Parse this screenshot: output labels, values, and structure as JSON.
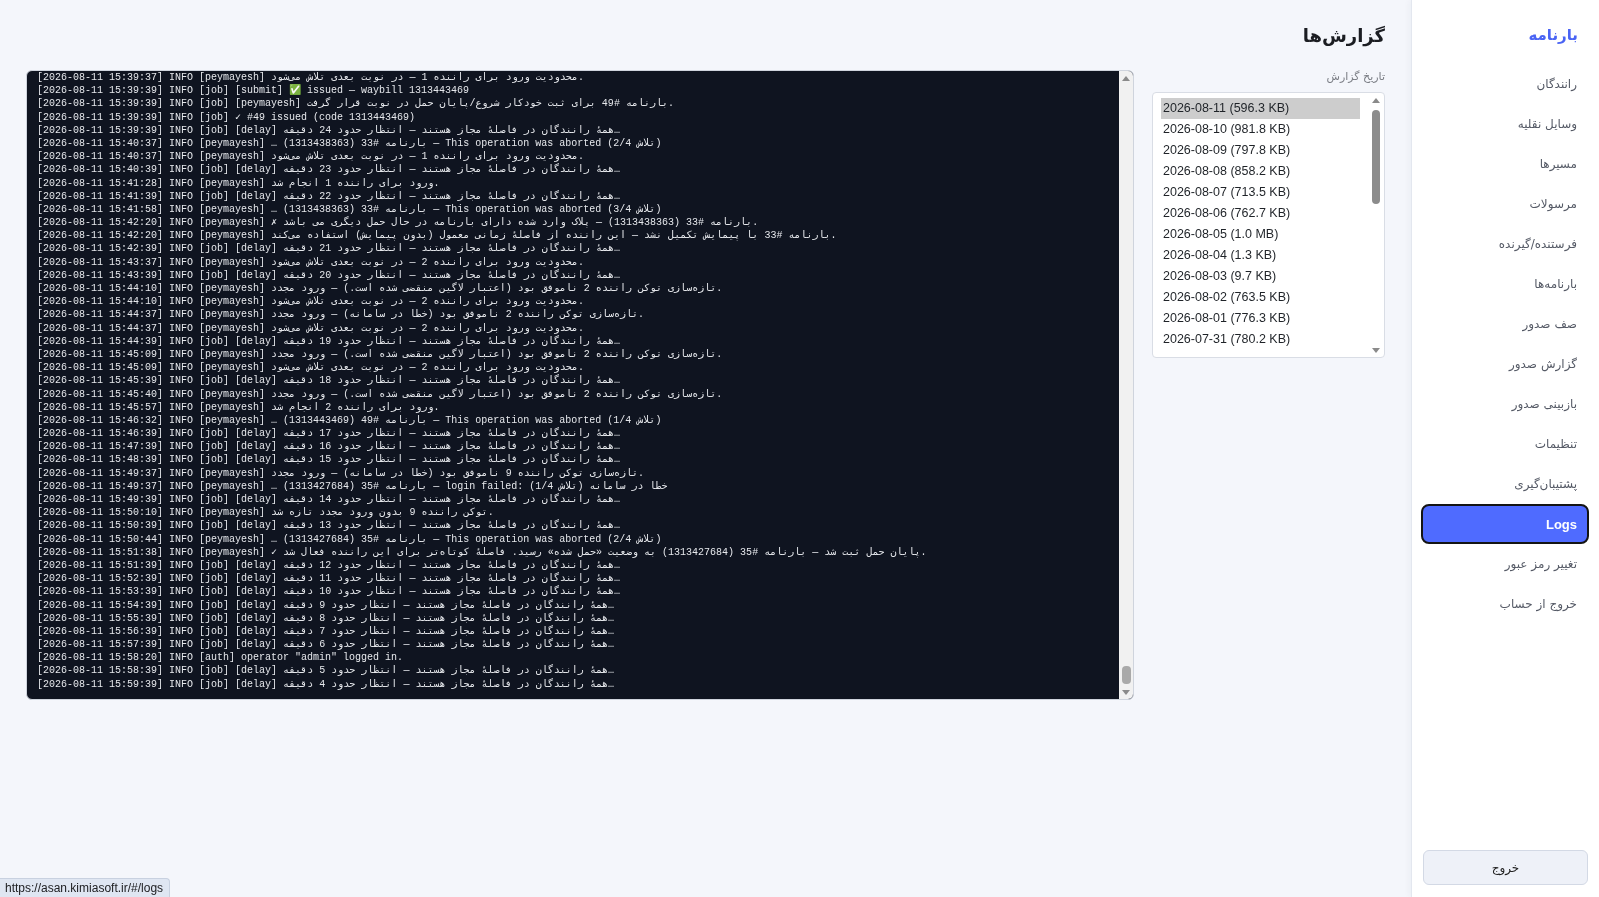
{
  "header": {
    "title": "گزارش‌ها"
  },
  "log": {
    "lines": [
      "[2026-08-11 15:39:37] INFO [peymayesh] محدودیت ورود برای راننده 1 — در نوبت بعدی تلاش می‌شود.",
      "[2026-08-11 15:39:39] INFO [job] [submit] ✅ issued — waybill 1313443469",
      "[2026-08-11 15:39:39] INFO [job] [peymayesh] بارنامه #49 برای ثبت خودکار شروع/پایان حمل در نوبت قرار گرفت.",
      "[2026-08-11 15:39:39] INFO [job] ✓ #49 issued (code 1313443469)",
      "[2026-08-11 15:39:39] INFO [job] [delay] همهٔ رانندگان در فاصلهٔ مجاز هستند — انتظار حدود 24 دقیقه…",
      "[2026-08-11 15:40:37] INFO [peymayesh] … بارنامه #33 (1313438363) — This operation was aborted (تلاش 2/4)",
      "[2026-08-11 15:40:37] INFO [peymayesh] محدودیت ورود برای راننده 1 — در نوبت بعدی تلاش می‌شود.",
      "[2026-08-11 15:40:39] INFO [job] [delay] همهٔ رانندگان در فاصلهٔ مجاز هستند — انتظار حدود 23 دقیقه…",
      "[2026-08-11 15:41:28] INFO [peymayesh] ورود برای راننده 1 انجام شد.",
      "[2026-08-11 15:41:39] INFO [job] [delay] همهٔ رانندگان در فاصلهٔ مجاز هستند — انتظار حدود 22 دقیقه…",
      "[2026-08-11 15:41:58] INFO [peymayesh] … بارنامه #33 (1313438363) — This operation was aborted (تلاش 3/4)",
      "[2026-08-11 15:42:20] INFO [peymayesh] ✗ بارنامه #33 (1313438363) — پلاک وارد شده دارای بارنامه در حال حمل دیگری می باشد.",
      "[2026-08-11 15:42:20] INFO [peymayesh] بارنامه #33 با پیمایش تکمیل نشد — این راننده از فاصلهٔ زمانی معمول (بدون پیمایش) استفاده می‌کند.",
      "[2026-08-11 15:42:39] INFO [job] [delay] همهٔ رانندگان در فاصلهٔ مجاز هستند — انتظار حدود 21 دقیقه…",
      "[2026-08-11 15:43:37] INFO [peymayesh] محدودیت ورود برای راننده 2 — در نوبت بعدی تلاش می‌شود.",
      "[2026-08-11 15:43:39] INFO [job] [delay] همهٔ رانندگان در فاصلهٔ مجاز هستند — انتظار حدود 20 دقیقه…",
      "[2026-08-11 15:44:10] INFO [peymayesh] تازه‌سازی توکن راننده 2 ناموفق بود (اعتبار لاگین منقضی شده است.) — ورود مجدد.",
      "[2026-08-11 15:44:10] INFO [peymayesh] محدودیت ورود برای راننده 2 — در نوبت بعدی تلاش می‌شود.",
      "[2026-08-11 15:44:37] INFO [peymayesh] تازه‌سازی توکن راننده 2 ناموفق بود (خطا در سامانه) — ورود مجدد.",
      "[2026-08-11 15:44:37] INFO [peymayesh] محدودیت ورود برای راننده 2 — در نوبت بعدی تلاش می‌شود.",
      "[2026-08-11 15:44:39] INFO [job] [delay] همهٔ رانندگان در فاصلهٔ مجاز هستند — انتظار حدود 19 دقیقه…",
      "[2026-08-11 15:45:09] INFO [peymayesh] تازه‌سازی توکن راننده 2 ناموفق بود (اعتبار لاگین منقضی شده است.) — ورود مجدد.",
      "[2026-08-11 15:45:09] INFO [peymayesh] محدودیت ورود برای راننده 2 — در نوبت بعدی تلاش می‌شود.",
      "[2026-08-11 15:45:39] INFO [job] [delay] همهٔ رانندگان در فاصلهٔ مجاز هستند — انتظار حدود 18 دقیقه…",
      "[2026-08-11 15:45:40] INFO [peymayesh] تازه‌سازی توکن راننده 2 ناموفق بود (اعتبار لاگین منقضی شده است.) — ورود مجدد.",
      "[2026-08-11 15:45:57] INFO [peymayesh] ورود برای راننده 2 انجام شد.",
      "[2026-08-11 15:46:32] INFO [peymayesh] … بارنامه #49 (1313443469) — This operation was aborted (تلاش 1/4)",
      "[2026-08-11 15:46:39] INFO [job] [delay] همهٔ رانندگان در فاصلهٔ مجاز هستند — انتظار حدود 17 دقیقه…",
      "[2026-08-11 15:47:39] INFO [job] [delay] همهٔ رانندگان در فاصلهٔ مجاز هستند — انتظار حدود 16 دقیقه…",
      "[2026-08-11 15:48:39] INFO [job] [delay] همهٔ رانندگان در فاصلهٔ مجاز هستند — انتظار حدود 15 دقیقه…",
      "[2026-08-11 15:49:37] INFO [peymayesh] تازه‌سازی توکن راننده 9 ناموفق بود (خطا در سامانه) — ورود مجدد.",
      "[2026-08-11 15:49:37] INFO [peymayesh] … بارنامه #35 (1313427684) — login failed: خطا در سامانه (تلاش 1/4)",
      "[2026-08-11 15:49:39] INFO [job] [delay] همهٔ رانندگان در فاصلهٔ مجاز هستند — انتظار حدود 14 دقیقه…",
      "[2026-08-11 15:50:10] INFO [peymayesh] توکن راننده 9 بدون ورود مجدد تازه شد.",
      "[2026-08-11 15:50:39] INFO [job] [delay] همهٔ رانندگان در فاصلهٔ مجاز هستند — انتظار حدود 13 دقیقه…",
      "[2026-08-11 15:50:44] INFO [peymayesh] … بارنامه #35 (1313427684) — This operation was aborted (تلاش 2/4)",
      "[2026-08-11 15:51:38] INFO [peymayesh] ✓ پایان حمل ثبت شد — بارنامه #35 (1313427684) به وضعیت «حمل شده» رسید. فاصلهٔ کوتاه‌تر برای این راننده فعال شد.",
      "[2026-08-11 15:51:39] INFO [job] [delay] همهٔ رانندگان در فاصلهٔ مجاز هستند — انتظار حدود 12 دقیقه…",
      "[2026-08-11 15:52:39] INFO [job] [delay] همهٔ رانندگان در فاصلهٔ مجاز هستند — انتظار حدود 11 دقیقه…",
      "[2026-08-11 15:53:39] INFO [job] [delay] همهٔ رانندگان در فاصلهٔ مجاز هستند — انتظار حدود 10 دقیقه…",
      "[2026-08-11 15:54:39] INFO [job] [delay] همهٔ رانندگان در فاصلهٔ مجاز هستند — انتظار حدود 9 دقیقه…",
      "[2026-08-11 15:55:39] INFO [job] [delay] همهٔ رانندگان در فاصلهٔ مجاز هستند — انتظار حدود 8 دقیقه…",
      "[2026-08-11 15:56:39] INFO [job] [delay] همهٔ رانندگان در فاصلهٔ مجاز هستند — انتظار حدود 7 دقیقه…",
      "[2026-08-11 15:57:39] INFO [job] [delay] همهٔ رانندگان در فاصلهٔ مجاز هستند — انتظار حدود 6 دقیقه…",
      "[2026-08-11 15:58:20] INFO [auth] operator \"admin\" logged in.",
      "[2026-08-11 15:58:39] INFO [job] [delay] همهٔ رانندگان در فاصلهٔ مجاز هستند — انتظار حدود 5 دقیقه…",
      "[2026-08-11 15:59:39] INFO [job] [delay] همهٔ رانندگان در فاصلهٔ مجاز هستند — انتظار حدود 4 دقیقه…"
    ]
  },
  "report_picker": {
    "label": "تاریخ گزارش",
    "items": [
      {
        "label": "2026-08-11 (596.3 KB)",
        "selected": true
      },
      {
        "label": "2026-08-10 (981.8 KB)",
        "selected": false
      },
      {
        "label": "2026-08-09 (797.8 KB)",
        "selected": false
      },
      {
        "label": "2026-08-08 (858.2 KB)",
        "selected": false
      },
      {
        "label": "2026-08-07 (713.5 KB)",
        "selected": false
      },
      {
        "label": "2026-08-06 (762.7 KB)",
        "selected": false
      },
      {
        "label": "2026-08-05 (1.0 MB)",
        "selected": false
      },
      {
        "label": "2026-08-04 (1.3 KB)",
        "selected": false
      },
      {
        "label": "2026-08-03 (9.7 KB)",
        "selected": false
      },
      {
        "label": "2026-08-02 (763.5 KB)",
        "selected": false
      },
      {
        "label": "2026-08-01 (776.3 KB)",
        "selected": false
      },
      {
        "label": "2026-07-31 (780.2 KB)",
        "selected": false
      }
    ]
  },
  "sidebar": {
    "brand": "بارنامه",
    "items": [
      {
        "label": "رانندگان",
        "selected": false
      },
      {
        "label": "وسایل نقلیه",
        "selected": false
      },
      {
        "label": "مسیرها",
        "selected": false
      },
      {
        "label": "مرسولات",
        "selected": false
      },
      {
        "label": "فرستنده/گیرنده",
        "selected": false
      },
      {
        "label": "بارنامه‌ها",
        "selected": false
      },
      {
        "label": "صف صدور",
        "selected": false
      },
      {
        "label": "گزارش صدور",
        "selected": false
      },
      {
        "label": "بازبینی صدور",
        "selected": false
      },
      {
        "label": "تنظیمات",
        "selected": false
      },
      {
        "label": "پشتیبان‌گیری",
        "selected": false
      },
      {
        "label": "Logs",
        "selected": true
      },
      {
        "label": "تغییر رمز عبور",
        "selected": false
      },
      {
        "label": "خروج از حساب",
        "selected": false
      }
    ],
    "logout_button": "خروج"
  },
  "status_url": "https://asan.kimiasoft.ir/#/logs"
}
